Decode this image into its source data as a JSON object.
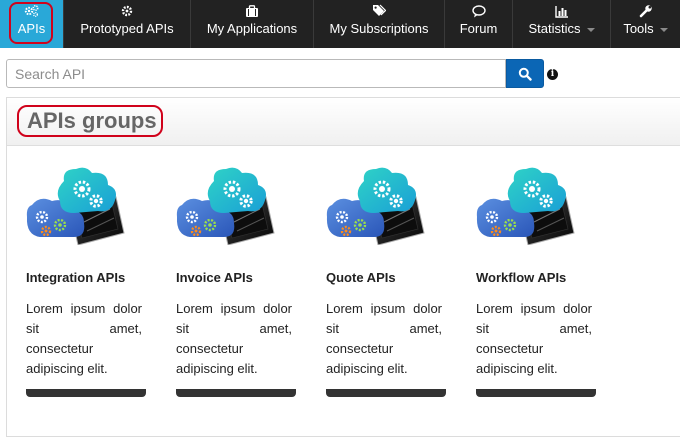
{
  "nav": {
    "items": [
      {
        "label": "APIs",
        "icon": "gears-icon",
        "active": true
      },
      {
        "label": "Prototyped APIs",
        "icon": "gear-icon"
      },
      {
        "label": "My Applications",
        "icon": "briefcase-icon"
      },
      {
        "label": "My Subscriptions",
        "icon": "tags-icon"
      },
      {
        "label": "Forum",
        "icon": "comment-icon"
      },
      {
        "label": "Statistics",
        "icon": "bar-chart-icon",
        "dropdown": true
      },
      {
        "label": "Tools",
        "icon": "wrench-icon",
        "dropdown": true
      }
    ]
  },
  "search": {
    "placeholder": "Search API",
    "value": ""
  },
  "panel": {
    "title": "APIs groups"
  },
  "groups": [
    {
      "title": "Integration APIs",
      "description": "Lorem ipsum dolor sit amet, consectetur adipiscing elit."
    },
    {
      "title": "Invoice APIs",
      "description": "Lorem ipsum dolor sit amet, consectetur adipiscing elit."
    },
    {
      "title": "Quote APIs",
      "description": "Lorem ipsum dolor sit amet, consectetur adipiscing elit."
    },
    {
      "title": "Workflow APIs",
      "description": "Lorem ipsum dolor sit amet, consectetur adipiscing elit."
    }
  ],
  "colors": {
    "navbar": "#222222",
    "active_tab": "#29a8d8",
    "highlight": "#d0021b",
    "search_button": "#0b66b5"
  }
}
